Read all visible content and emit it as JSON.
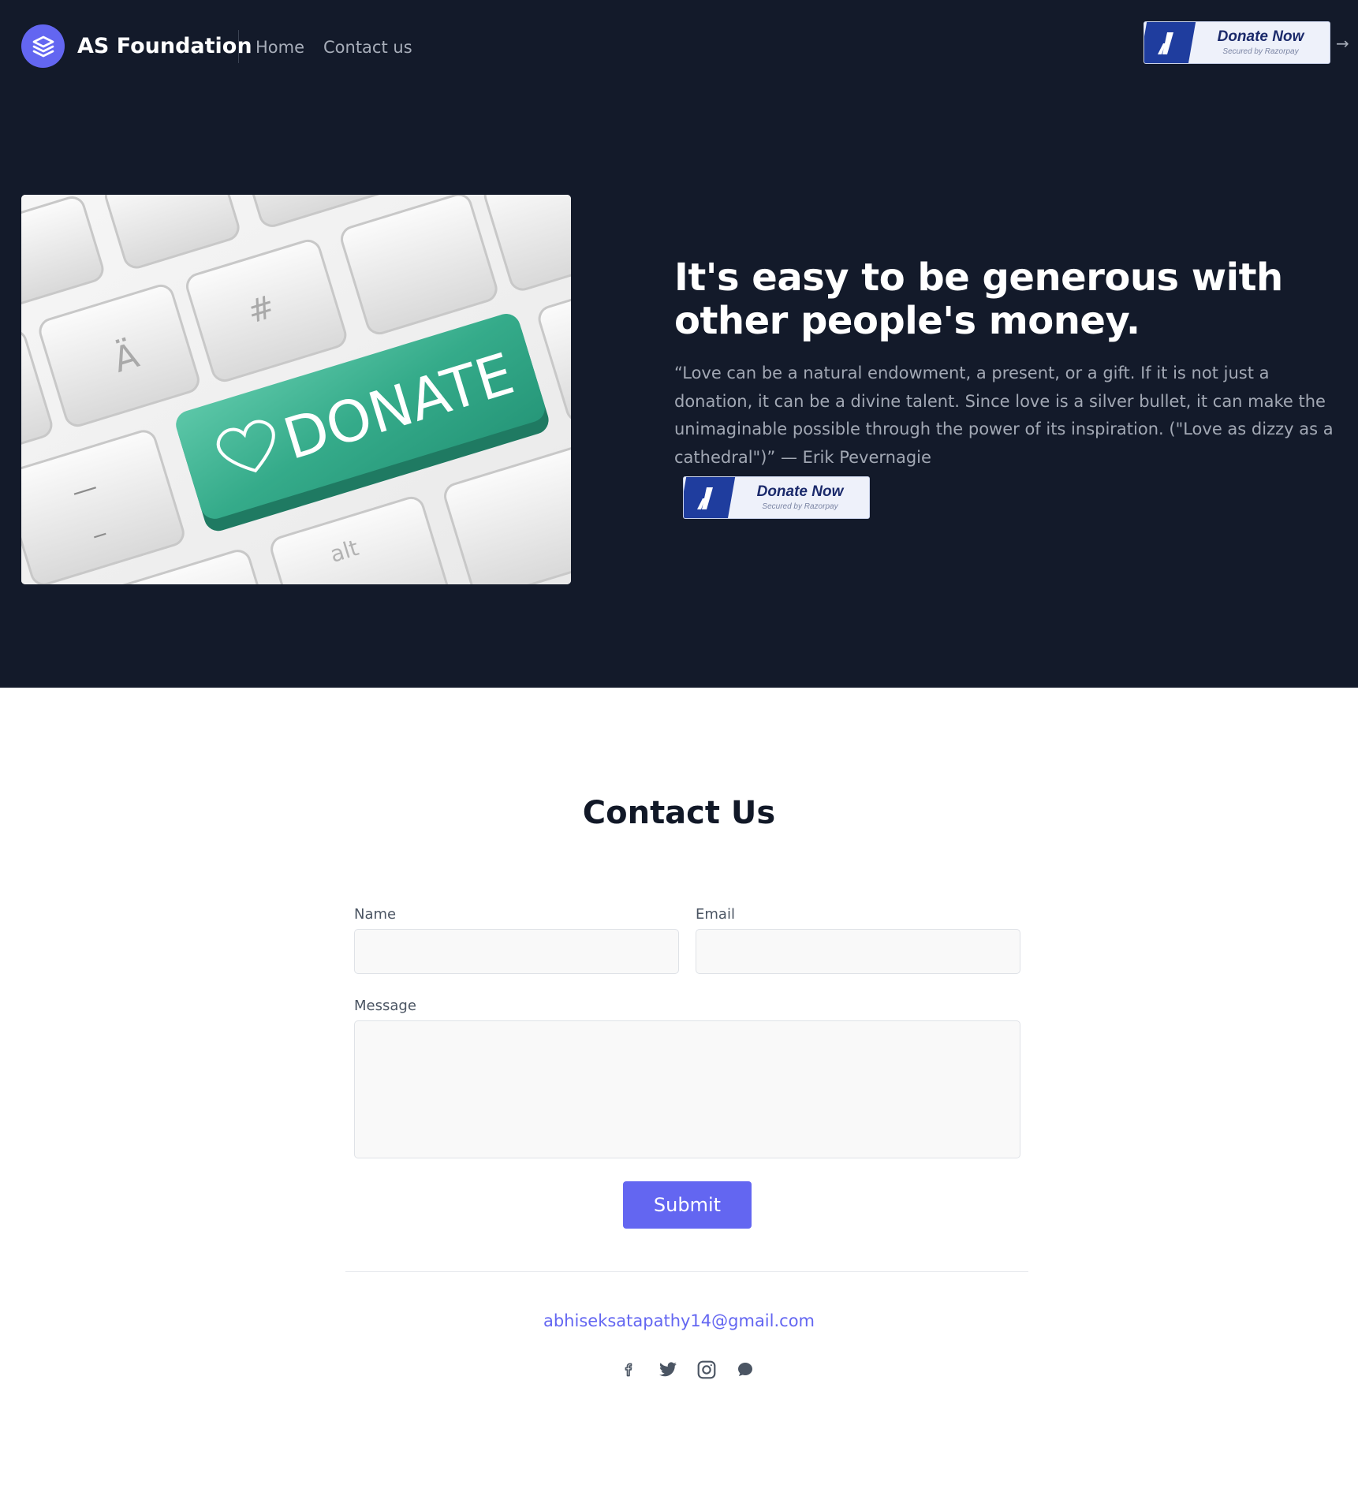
{
  "header": {
    "brand": "AS Foundation",
    "nav": {
      "home": "Home",
      "contact": "Contact us"
    },
    "donate": {
      "title": "Donate Now",
      "subtitle": "Secured by Razorpay"
    },
    "arrow_icon": "arrow-right-icon"
  },
  "hero": {
    "image_key_main": "DONATE",
    "image_key_a": "Ä",
    "image_key_hash": "#",
    "image_key_alt": "alt",
    "image_key_dash1": "—",
    "image_key_dash2": "_",
    "title": "It's easy to be generous with other people's money.",
    "quote": "“Love can be a natural endowment, a present, or a gift. If it is not just a donation, it can be a divine talent. Since love is a silver bullet, it can make the unimaginable possible through the power of its inspiration. (\"Love as dizzy as a cathedral\")” — Erik Pevernagie",
    "donate": {
      "title": "Donate Now",
      "subtitle": "Secured by Razorpay"
    }
  },
  "contact": {
    "title": "Contact Us",
    "name_label": "Name",
    "name_value": "",
    "email_label": "Email",
    "email_value": "",
    "message_label": "Message",
    "message_value": "",
    "submit_label": "Submit"
  },
  "footer": {
    "email": "abhiseksatapathy14@gmail.com",
    "socials": [
      "facebook-icon",
      "twitter-icon",
      "instagram-icon",
      "chat-icon"
    ]
  },
  "colors": {
    "dark_bg": "#131a2a",
    "accent": "#6366f1",
    "razorpay_blue": "#1f3d9e"
  }
}
